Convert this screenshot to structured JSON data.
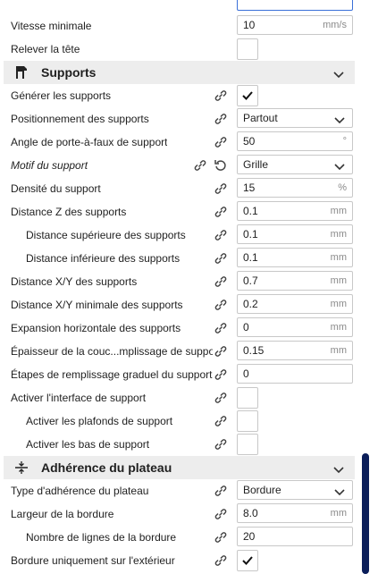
{
  "rows_top": [
    {
      "label": "Vitesse minimale",
      "value": "10",
      "unit": "mm/s"
    },
    {
      "label": "Relever la tête",
      "checked": false
    }
  ],
  "supports": {
    "title": "Supports",
    "rows": [
      {
        "label": "Générer les supports",
        "checked": true
      },
      {
        "label": "Positionnement des supports",
        "select": "Partout"
      },
      {
        "label": "Angle de porte-à-faux de support",
        "value": "50",
        "unit": "°"
      },
      {
        "label": "Motif du support",
        "select": "Grille"
      },
      {
        "label": "Densité du support",
        "value": "15",
        "unit": "%"
      },
      {
        "label": "Distance Z des supports",
        "value": "0.1",
        "unit": "mm"
      },
      {
        "label": "Distance supérieure des supports",
        "value": "0.1",
        "unit": "mm"
      },
      {
        "label": "Distance inférieure des supports",
        "value": "0.1",
        "unit": "mm"
      },
      {
        "label": "Distance X/Y des supports",
        "value": "0.7",
        "unit": "mm"
      },
      {
        "label": "Distance X/Y minimale des supports",
        "value": "0.2",
        "unit": "mm"
      },
      {
        "label": "Expansion horizontale des supports",
        "value": "0",
        "unit": "mm"
      },
      {
        "label": "Épaisseur de la couc...mplissage de support",
        "value": "0.15",
        "unit": "mm"
      },
      {
        "label": "Étapes de remplissage graduel du support",
        "value": "0",
        "unit": ""
      },
      {
        "label": "Activer l'interface de support",
        "checked": false
      },
      {
        "label": "Activer les plafonds de support",
        "checked": false
      },
      {
        "label": "Activer les bas de support",
        "checked": false
      }
    ]
  },
  "adhesion": {
    "title": "Adhérence du plateau",
    "rows": [
      {
        "label": "Type d'adhérence du plateau",
        "select": "Bordure"
      },
      {
        "label": "Largeur de la bordure",
        "value": "8.0",
        "unit": "mm"
      },
      {
        "label": "Nombre de lignes de la bordure",
        "value": "20",
        "unit": ""
      },
      {
        "label": "Bordure uniquement sur l'extérieur",
        "checked": true
      }
    ]
  }
}
